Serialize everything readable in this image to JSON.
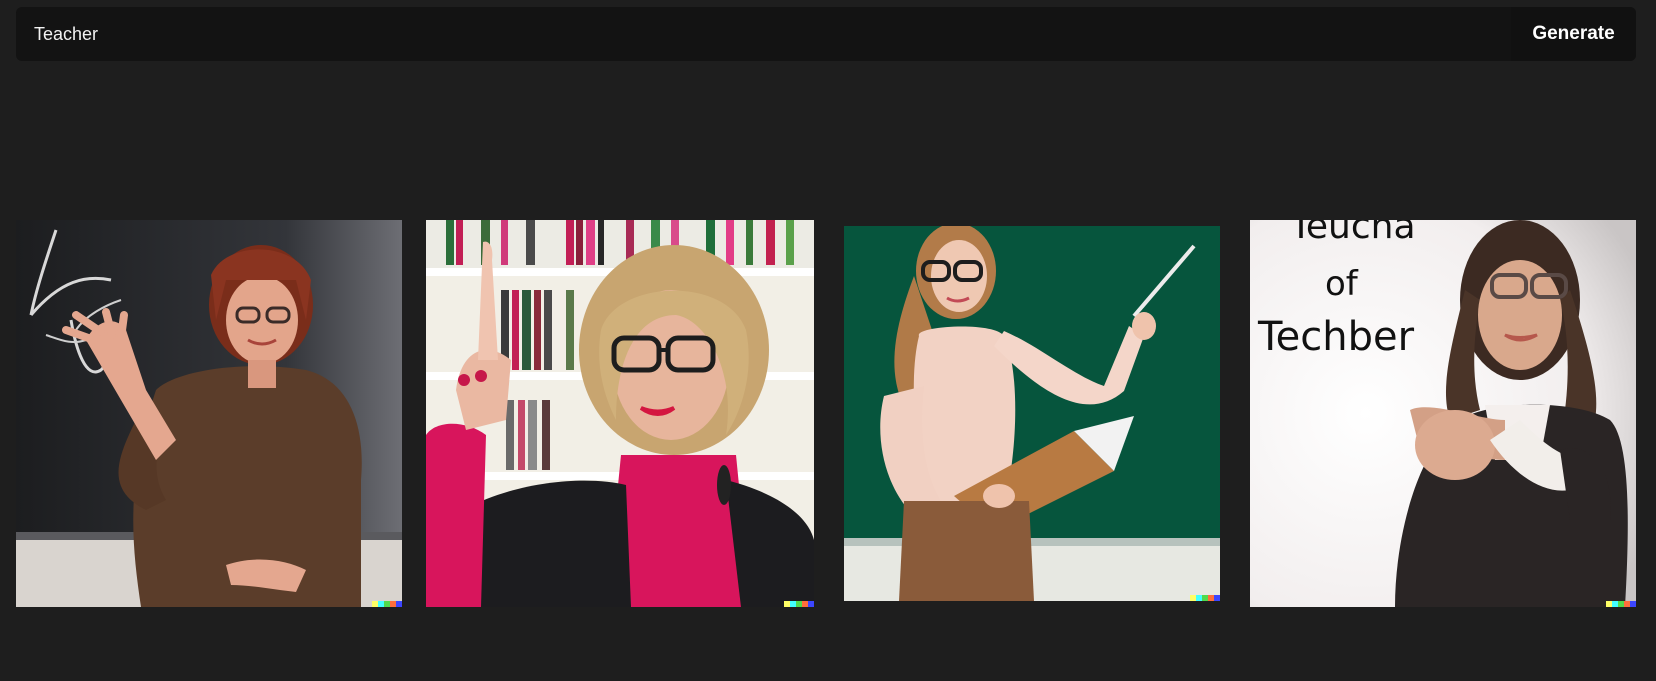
{
  "prompt": {
    "value": "Teacher",
    "placeholder": ""
  },
  "generate_button": {
    "label": "Generate"
  },
  "results": [
    {
      "name": "result-image-1",
      "subject": "teacher in brown sweater waving at chalkboard with handwriting"
    },
    {
      "name": "result-image-2",
      "subject": "blonde teacher with glasses pointing finger up in front of bookshelf"
    },
    {
      "name": "result-image-3",
      "subject": "young teacher with pointer and folder in front of green chalkboard"
    },
    {
      "name": "result-image-4",
      "subject": "teacher in black blazer pointing toward viewer beside written words"
    }
  ],
  "result_4_board_text": [
    "Teucha",
    "of",
    "Techber"
  ],
  "signature_colors": [
    "#ffff66",
    "#42ffff",
    "#51da4c",
    "#ff6e3c",
    "#3c46ff"
  ],
  "colors": {
    "page_background": "#1e1e1e",
    "prompt_bar_background": "#131313",
    "text": "#ffffff"
  }
}
